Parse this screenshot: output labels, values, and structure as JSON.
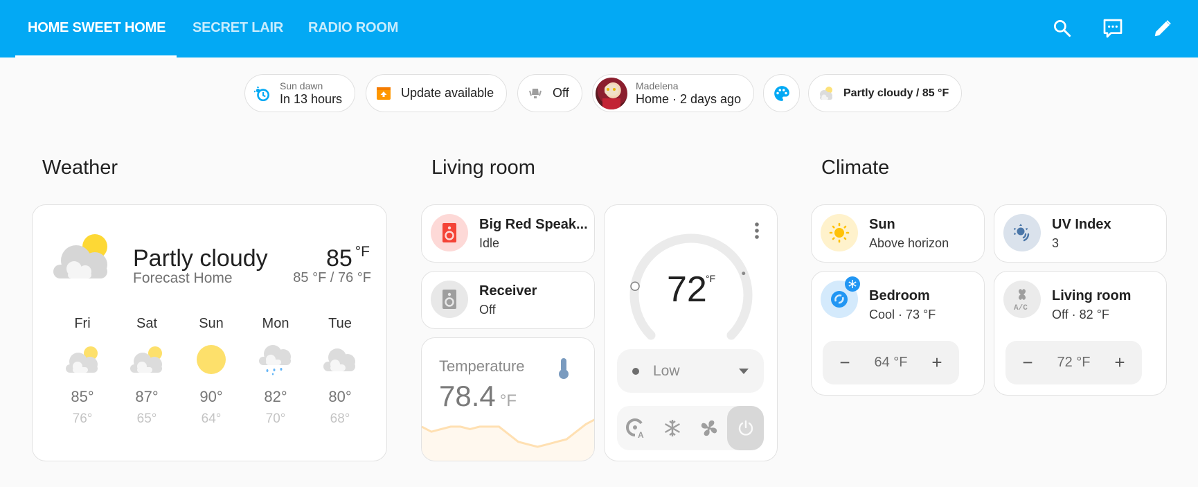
{
  "header": {
    "tabs": [
      {
        "label": "HOME SWEET HOME",
        "active": true
      },
      {
        "label": "SECRET LAIR",
        "active": false
      },
      {
        "label": "RADIO ROOM",
        "active": false
      }
    ],
    "actions": [
      "search-icon",
      "assist-icon",
      "edit-icon"
    ],
    "color": "#03a9f4"
  },
  "badges": [
    {
      "icon": "sun-clock-icon",
      "label": "Sun dawn",
      "value": "In 13 hours"
    },
    {
      "icon": "package-up-icon",
      "value": "Update available"
    },
    {
      "icon": "ceiling-light-icon",
      "value": "Off"
    },
    {
      "icon": "person-avatar",
      "label": "Madelena",
      "value": "Home · 2 days ago"
    },
    {
      "icon": "palette-icon"
    },
    {
      "icon": "partly-cloudy-icon",
      "value": "Partly cloudy / 85 °F"
    }
  ],
  "weather": {
    "title": "Weather",
    "condition": "Partly cloudy",
    "source": "Forecast Home",
    "temperature": "85",
    "unit": "°F",
    "range": "85 °F / 76 °F",
    "forecast": [
      {
        "day": "Fri",
        "icon": "partly-cloudy",
        "high": "85°",
        "low": "76°"
      },
      {
        "day": "Sat",
        "icon": "partly-cloudy",
        "high": "87°",
        "low": "65°"
      },
      {
        "day": "Sun",
        "icon": "sunny",
        "high": "90°",
        "low": "64°"
      },
      {
        "day": "Mon",
        "icon": "rainy",
        "high": "82°",
        "low": "70°"
      },
      {
        "day": "Tue",
        "icon": "cloudy",
        "high": "80°",
        "low": "68°"
      }
    ]
  },
  "living_room": {
    "title": "Living room",
    "speaker": {
      "name": "Big Red Speak...",
      "state": "Idle",
      "color": "#f44336"
    },
    "receiver": {
      "name": "Receiver",
      "state": "Off"
    },
    "temperature_sensor": {
      "name": "Temperature",
      "value": "78.4",
      "unit": "°F",
      "history": [
        78.1,
        77.9,
        78.0,
        78.1,
        78.1,
        78.0,
        78.1,
        78.1,
        78.1,
        77.8,
        77.5,
        77.4,
        77.3,
        77.4,
        77.5,
        77.6,
        77.9,
        78.2,
        78.4
      ]
    },
    "thermostat": {
      "target": "72",
      "unit": "°F",
      "target_fraction": 0.2,
      "current_fraction": 0.75,
      "fan_mode": "Low",
      "modes": [
        "auto-mode-icon",
        "snowflake-icon",
        "fan-icon",
        "power-icon"
      ],
      "active_mode": "off"
    }
  },
  "climate": {
    "title": "Climate",
    "sun": {
      "name": "Sun",
      "state": "Above horizon"
    },
    "uv": {
      "name": "UV Index",
      "state": "3"
    },
    "bedroom": {
      "name": "Bedroom",
      "state": "Cool · 73 °F",
      "setpoint": "64 °F"
    },
    "living": {
      "name": "Living room",
      "state": "Off · 82 °F",
      "setpoint": "72 °F"
    },
    "minus": "−",
    "plus": "+"
  }
}
